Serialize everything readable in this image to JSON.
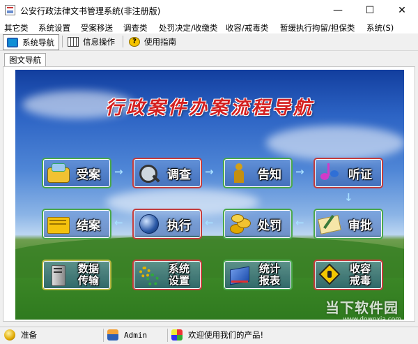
{
  "window": {
    "title": "公安行政法律文书管理系统(非注册版)",
    "minimize": "—",
    "maximize": "☐",
    "close": "✕"
  },
  "menu": {
    "items": [
      "其它类",
      "系统设置",
      "受案移送",
      "调查类",
      "处罚决定/收缴类",
      "收容/戒毒类",
      "暂缓执行拘留/担保类",
      "系统(S)"
    ]
  },
  "toolbar": {
    "tabs": [
      {
        "label": "系统导航",
        "icon": "monitor-icon"
      },
      {
        "label": "信息操作",
        "icon": "grid-icon"
      },
      {
        "label": "使用指南",
        "icon": "help-icon"
      }
    ]
  },
  "subtab": {
    "label": "图文导航"
  },
  "nav": {
    "title": "行政案件办案流程导航",
    "buttons": {
      "accept": "受案",
      "investigate": "调查",
      "notify": "告知",
      "hearing": "听证",
      "close_case": "结案",
      "execute": "执行",
      "punish": "处罚",
      "review": "审批",
      "data_line1": "数据",
      "data_line2": "传输",
      "settings_line1": "系统",
      "settings_line2": "设置",
      "stats_line1": "统计",
      "stats_line2": "报表",
      "custody_line1": "收容",
      "custody_line2": "戒毒"
    },
    "arrows": {
      "right": "→",
      "left": "←",
      "down": "↓"
    }
  },
  "watermark": {
    "name": "当下软件园",
    "url": "www.downxia.com"
  },
  "status": {
    "state": "准备",
    "user": "Admin",
    "message": "欢迎使用我们的产品!"
  },
  "colors": {
    "title_red": "#d42020",
    "sky_blue": "#2c63c4",
    "grass_green": "#3f8a28"
  }
}
